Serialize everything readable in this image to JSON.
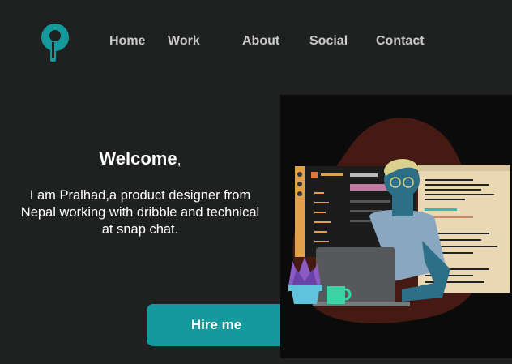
{
  "brand": {
    "logo_icon": "location-pin-logo",
    "accent_color": "#14999c"
  },
  "nav": {
    "items": [
      {
        "label": "Home"
      },
      {
        "label": "Work"
      },
      {
        "label": "About"
      },
      {
        "label": "Social"
      },
      {
        "label": "Contact"
      }
    ]
  },
  "hero": {
    "welcome": "Welcome",
    "welcome_comma": ",",
    "intro_lines": [
      "I am Pralhad,a product designer from",
      "Nepal working with dribble and technical",
      "at snap chat."
    ],
    "cta_label": "Hire me"
  }
}
